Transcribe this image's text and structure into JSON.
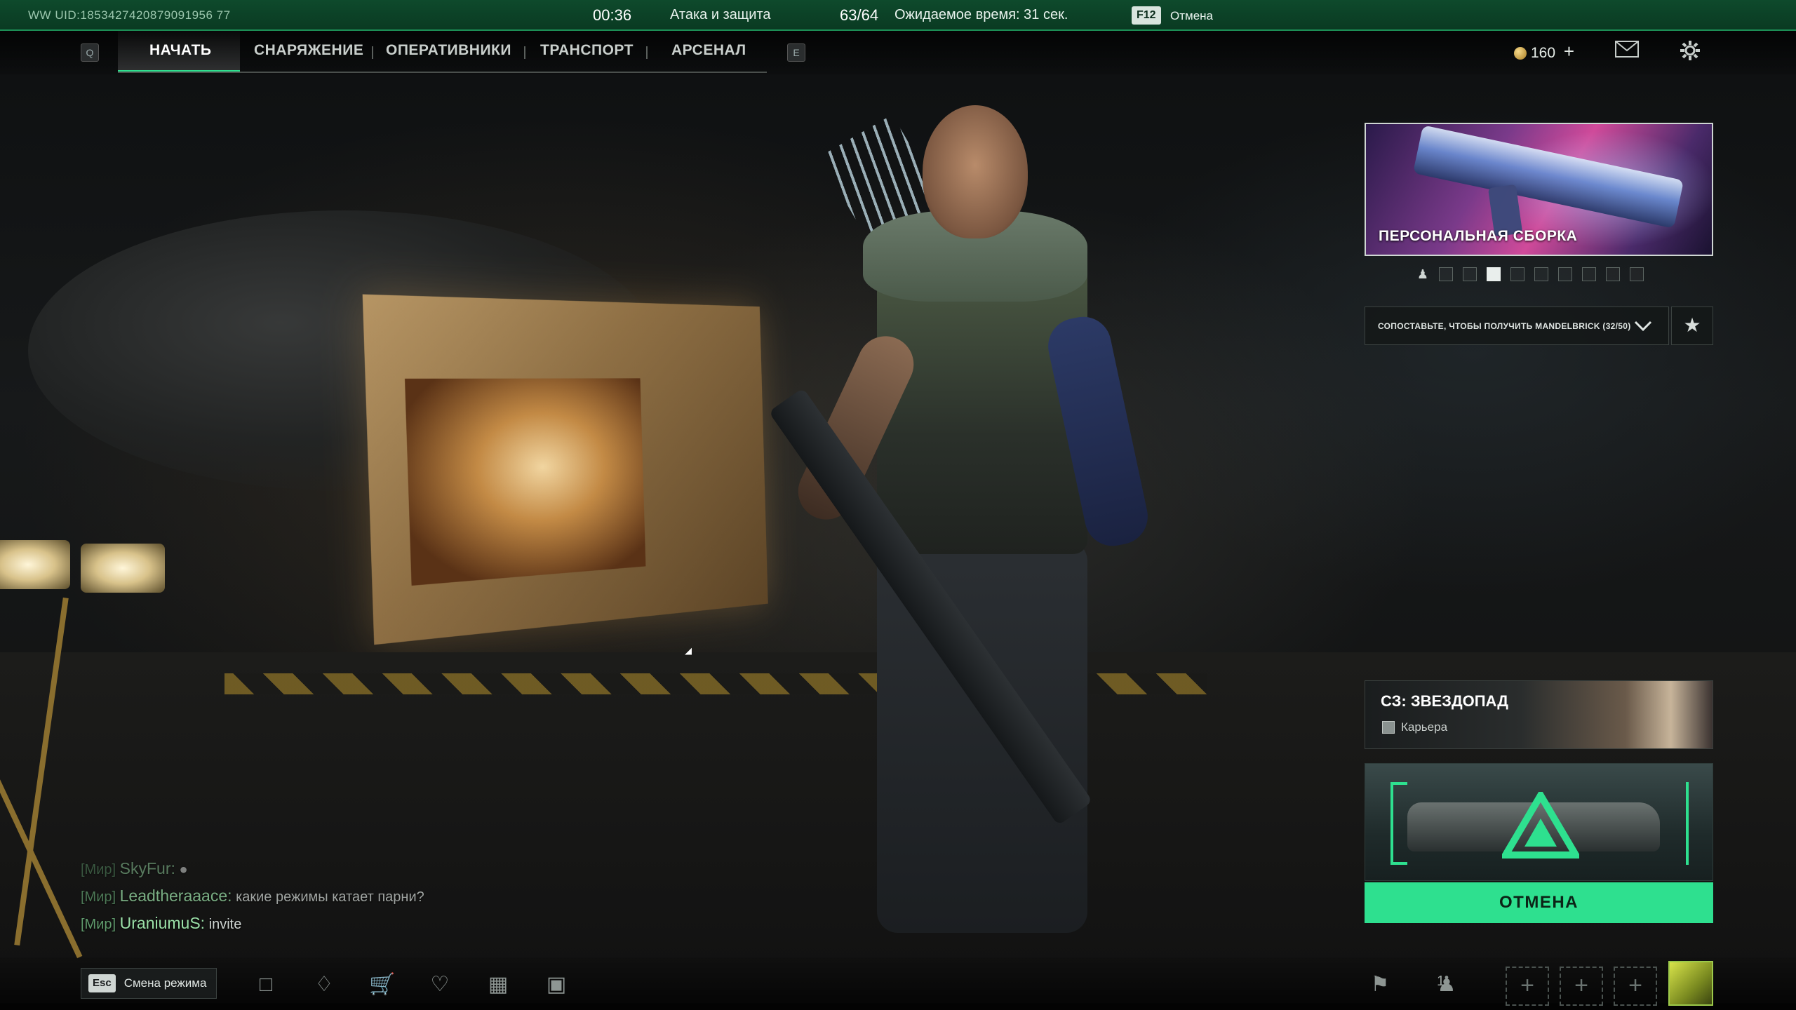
{
  "topbar": {
    "uid": "WW UID:1853427420879091956 77",
    "timer": "00:36",
    "mode": "Атака и защита",
    "players": "63/64",
    "eta": "Ожидаемое время: 31 сек.",
    "cancel_key": "F12",
    "cancel_label": "Отмена"
  },
  "nav": {
    "prev_key": "Q",
    "next_key": "E",
    "tabs": [
      "НАЧАТЬ",
      "СНАРЯЖЕНИЕ",
      "ОПЕРАТИВНИКИ",
      "ТРАНСПОРТ",
      "АРСЕНАЛ"
    ],
    "active_tab": "НАЧАТЬ",
    "currency": "160",
    "currency_plus": "+"
  },
  "loadout": {
    "label": "ПЕРСОНАЛЬНАЯ СБОРКА",
    "pages_total": 9,
    "active_page": 4
  },
  "challenge": {
    "text": "СОПОСТАВЬТЕ, ЧТОБЫ ПОЛУЧИТЬ MANDELBRICK (32/50)"
  },
  "season": {
    "title": "СЗ: ЗВЕЗДОПАД",
    "subtitle": "Карьера"
  },
  "match": {
    "cancel_label": "ОТМЕНА"
  },
  "chat": [
    {
      "channel": "[Мир]",
      "nick": "SkyFur:",
      "message": ""
    },
    {
      "channel": "[Мир]",
      "nick": "Leadtheraaace:",
      "message": "какие режимы катает парни?"
    },
    {
      "channel": "[Мир]",
      "nick": "UraniumuS:",
      "message": "invite"
    }
  ],
  "bottombar": {
    "esc_key": "Esc",
    "esc_label": "Смена режима",
    "party_count": "1"
  },
  "colors": {
    "accent": "#2ee08f",
    "topbar": "#0e4a2c"
  }
}
